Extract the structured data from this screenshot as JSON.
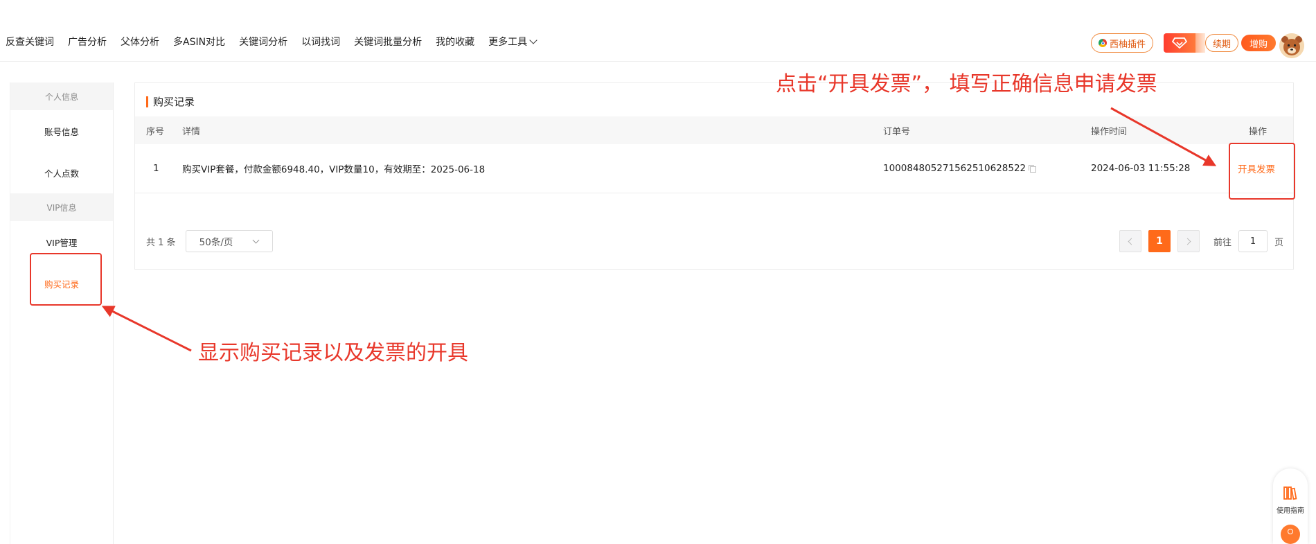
{
  "nav": {
    "links": [
      "反查关键词",
      "广告分析",
      "父体分析",
      "多ASIN对比",
      "关键词分析",
      "以词找词",
      "关键词批量分析",
      "我的收藏"
    ],
    "more_label": "更多工具",
    "plugin_label": "西柚插件",
    "renew_label": "续期",
    "buy_label": "增购"
  },
  "sidebar": {
    "group_personal": "个人信息",
    "item_account": "账号信息",
    "item_points": "个人点数",
    "group_vip": "VIP信息",
    "item_vip_manage": "VIP管理",
    "item_purchase": "购买记录"
  },
  "panel": {
    "title": "购买记录",
    "columns": {
      "no": "序号",
      "detail": "详情",
      "order": "订单号",
      "time": "操作时间",
      "action": "操作"
    },
    "rows": [
      {
        "no": "1",
        "detail": "购买VIP套餐，付款金额6948.40，VIP数量10，有效期至：2025-06-18",
        "order": "10008480527156251062852​2",
        "time": "2024-06-03 11:55:28",
        "action": "开具发票"
      }
    ]
  },
  "pagination": {
    "total": "共 1 条",
    "page_size": "50条/页",
    "current_page": "1",
    "goto_label": "前往",
    "goto_value": "1",
    "page_suffix": "页"
  },
  "annotations": {
    "top": "点击“开具发票”， 填写正确信息申请发票",
    "bottom": "显示购买记录以及发票的开具"
  },
  "helper": {
    "guide_label": "使用指南"
  },
  "colors": {
    "accent": "#ff6a1a",
    "annotation": "#e8372a"
  }
}
